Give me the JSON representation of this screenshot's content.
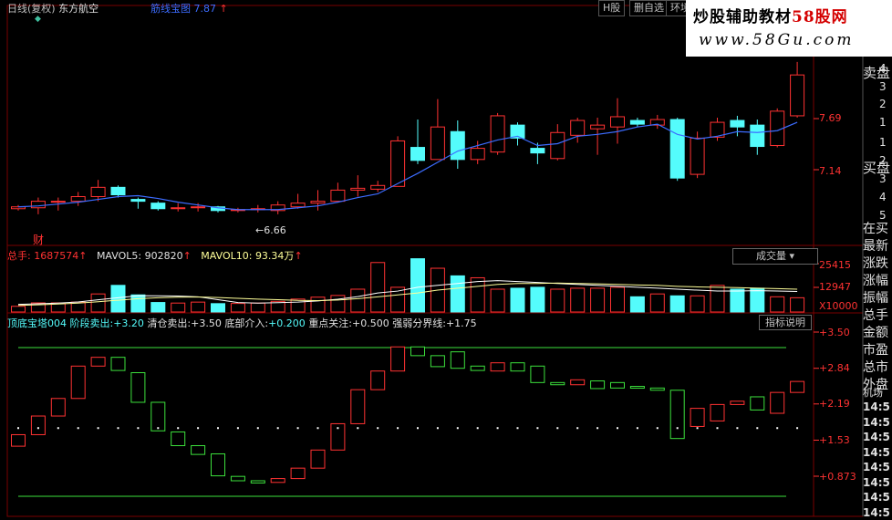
{
  "header": {
    "title": "日线(复权)",
    "stock": "东方航空",
    "indicator": "筋线宝图",
    "price": "7.87",
    "tabs": [
      "H股",
      "删自选",
      "环境"
    ]
  },
  "watermark": {
    "line1_a": "炒股辅助教材",
    "line1_b": "58股网",
    "line2": "www.58Gu.com"
  },
  "colors": {
    "up": "#ff3232",
    "down": "#54fcfc",
    "ma": "#ffffff",
    "ma2": "#ffff99",
    "bluebar": "#3c6cff"
  },
  "price_panel": {
    "ticks": [
      "7.69",
      "7.14"
    ],
    "low_label": "6.66",
    "cai_label": "财",
    "sell_label": "卖盘",
    "buy_label": "买盘",
    "sell_levels": [
      "4",
      "3",
      "2",
      "1"
    ],
    "buy_levels": [
      "1",
      "2",
      "3",
      "4",
      "5"
    ]
  },
  "volume_panel": {
    "total_label": "总手:",
    "total_value": "1687574",
    "mavol5_label": "MAVOL5:",
    "mavol5_value": "902820",
    "mavol10_label": "MAVOL10:",
    "mavol10_value": "93.34万",
    "ticks": [
      "25415",
      "12947",
      "X10000"
    ],
    "dropdown": "成交量"
  },
  "indicator_panel": {
    "name": "顶底宝塔004",
    "items": [
      {
        "label": "阶段卖出:",
        "value": "+3.20"
      },
      {
        "label": "清仓卖出:",
        "value": "+3.50"
      },
      {
        "label": "底部介入:",
        "value": "+0.200"
      },
      {
        "label": "重点关注:",
        "value": "+0.500"
      },
      {
        "label": "强弱分界线:",
        "value": "+1.75"
      }
    ],
    "ticks": [
      "+3.50",
      "+2.84",
      "+2.19",
      "+1.53",
      "+0.873"
    ],
    "button": "指标说明"
  },
  "sidebar": {
    "labels": [
      "在买",
      "最新",
      "涨跌",
      "涨幅",
      "振幅",
      "总手",
      "金额",
      "市盈",
      "总市",
      "外盘"
    ],
    "section": "机场",
    "times": [
      "14:5",
      "14:5",
      "14:5",
      "14:5",
      "14:5",
      "14:5",
      "14:5",
      "14:5"
    ]
  },
  "chart_data": [
    {
      "type": "candlestick",
      "title": "东方航空 日线",
      "yticks": [
        7.69,
        7.14
      ],
      "candles": [
        {
          "o": 6.72,
          "c": 6.74,
          "h": 6.76,
          "l": 6.7
        },
        {
          "o": 6.73,
          "c": 6.8,
          "h": 6.84,
          "l": 6.66
        },
        {
          "o": 6.8,
          "c": 6.8,
          "h": 6.84,
          "l": 6.7
        },
        {
          "o": 6.8,
          "c": 6.85,
          "h": 6.9,
          "l": 6.75
        },
        {
          "o": 6.85,
          "c": 6.95,
          "h": 7.03,
          "l": 6.8
        },
        {
          "o": 6.95,
          "c": 6.87,
          "h": 6.97,
          "l": 6.84
        },
        {
          "o": 6.82,
          "c": 6.8,
          "h": 6.84,
          "l": 6.72
        },
        {
          "o": 6.78,
          "c": 6.72,
          "h": 6.8,
          "l": 6.7
        },
        {
          "o": 6.72,
          "c": 6.73,
          "h": 6.78,
          "l": 6.69
        },
        {
          "o": 6.73,
          "c": 6.74,
          "h": 6.78,
          "l": 6.69
        },
        {
          "o": 6.74,
          "c": 6.7,
          "h": 6.75,
          "l": 6.68
        },
        {
          "o": 6.7,
          "c": 6.71,
          "h": 6.73,
          "l": 6.68
        },
        {
          "o": 6.71,
          "c": 6.72,
          "h": 6.76,
          "l": 6.68
        },
        {
          "o": 6.7,
          "c": 6.76,
          "h": 6.8,
          "l": 6.66
        },
        {
          "o": 6.74,
          "c": 6.78,
          "h": 6.88,
          "l": 6.72
        },
        {
          "o": 6.78,
          "c": 6.8,
          "h": 6.92,
          "l": 6.7
        },
        {
          "o": 6.8,
          "c": 6.92,
          "h": 7.0,
          "l": 6.8
        },
        {
          "o": 6.92,
          "c": 6.94,
          "h": 7.08,
          "l": 6.85
        },
        {
          "o": 6.93,
          "c": 6.97,
          "h": 7.02,
          "l": 6.9
        },
        {
          "o": 6.96,
          "c": 7.45,
          "h": 7.5,
          "l": 6.96
        },
        {
          "o": 7.38,
          "c": 7.24,
          "h": 7.68,
          "l": 7.2
        },
        {
          "o": 7.25,
          "c": 7.6,
          "h": 7.9,
          "l": 7.25
        },
        {
          "o": 7.55,
          "c": 7.25,
          "h": 7.67,
          "l": 7.15
        },
        {
          "o": 7.25,
          "c": 7.37,
          "h": 7.45,
          "l": 7.2
        },
        {
          "o": 7.33,
          "c": 7.72,
          "h": 7.75,
          "l": 7.3
        },
        {
          "o": 7.62,
          "c": 7.48,
          "h": 7.65,
          "l": 7.4
        },
        {
          "o": 7.37,
          "c": 7.32,
          "h": 7.43,
          "l": 7.2
        },
        {
          "o": 7.26,
          "c": 7.54,
          "h": 7.63,
          "l": 7.24
        },
        {
          "o": 7.51,
          "c": 7.67,
          "h": 7.7,
          "l": 7.43
        },
        {
          "o": 7.58,
          "c": 7.62,
          "h": 7.7,
          "l": 7.3
        },
        {
          "o": 7.6,
          "c": 7.71,
          "h": 7.91,
          "l": 7.42
        },
        {
          "o": 7.67,
          "c": 7.63,
          "h": 7.7,
          "l": 7.6
        },
        {
          "o": 7.62,
          "c": 7.68,
          "h": 7.73,
          "l": 7.58
        },
        {
          "o": 7.68,
          "c": 7.05,
          "h": 7.7,
          "l": 7.02
        },
        {
          "o": 7.09,
          "c": 7.48,
          "h": 7.55,
          "l": 7.05
        },
        {
          "o": 7.49,
          "c": 7.65,
          "h": 7.7,
          "l": 7.45
        },
        {
          "o": 7.67,
          "c": 7.6,
          "h": 7.72,
          "l": 7.5
        },
        {
          "o": 7.62,
          "c": 7.39,
          "h": 7.68,
          "l": 7.3
        },
        {
          "o": 7.4,
          "c": 7.77,
          "h": 7.8,
          "l": 7.38
        },
        {
          "o": 7.72,
          "c": 8.16,
          "h": 8.3,
          "l": 7.7
        }
      ],
      "ma": [
        6.74,
        6.75,
        6.77,
        6.79,
        6.82,
        6.85,
        6.86,
        6.83,
        6.79,
        6.76,
        6.73,
        6.71,
        6.71,
        6.71,
        6.73,
        6.75,
        6.79,
        6.84,
        6.88,
        6.99,
        7.1,
        7.22,
        7.34,
        7.4,
        7.46,
        7.5,
        7.4,
        7.42,
        7.5,
        7.52,
        7.55,
        7.6,
        7.63,
        7.52,
        7.47,
        7.5,
        7.55,
        7.54,
        7.56,
        7.65
      ]
    },
    {
      "type": "bar",
      "title": "成交量",
      "yticks": [
        25415,
        12947
      ],
      "values": [
        3000,
        4800,
        4800,
        5200,
        9500,
        14000,
        9000,
        5000,
        4700,
        5200,
        4400,
        4500,
        4700,
        5600,
        6800,
        7800,
        8700,
        12000,
        26000,
        13000,
        28000,
        23000,
        19000,
        18000,
        12000,
        12500,
        13000,
        12000,
        12500,
        12500,
        13000,
        8000,
        9500,
        8500,
        8500,
        14000,
        12000,
        12500,
        8000,
        7500
      ],
      "mavol5": [
        4000,
        4300,
        4700,
        5300,
        6400,
        7500,
        8600,
        8500,
        8400,
        8000,
        6500,
        5000,
        4700,
        4900,
        5200,
        5800,
        6700,
        8100,
        10000,
        11000,
        13000,
        14000,
        15000,
        16000,
        16500,
        16000,
        15500,
        15000,
        14500,
        14000,
        13500,
        13000,
        12500,
        12000,
        11500,
        11000,
        11000,
        11200,
        11000,
        10800
      ],
      "mavol10": [
        3500,
        3800,
        4200,
        4700,
        5400,
        6200,
        7000,
        7500,
        7800,
        7900,
        7600,
        7200,
        6800,
        6500,
        6100,
        6000,
        6300,
        7000,
        8000,
        9000,
        10000,
        11500,
        12500,
        13500,
        14500,
        15000,
        15000,
        15200,
        15000,
        14800,
        14500,
        14200,
        14000,
        13500,
        13200,
        13000,
        12800,
        12500,
        12300,
        12000
      ]
    },
    {
      "type": "bar",
      "title": "顶底宝塔004",
      "yticks": [
        3.5,
        2.84,
        2.19,
        1.53,
        0.873
      ],
      "strength_line": 1.75,
      "bars": [
        {
          "o": 1.42,
          "c": 1.63
        },
        {
          "o": 1.63,
          "c": 1.97
        },
        {
          "o": 1.97,
          "c": 2.29
        },
        {
          "o": 2.29,
          "c": 2.88
        },
        {
          "o": 2.88,
          "c": 3.04
        },
        {
          "o": 3.04,
          "c": 2.8
        },
        {
          "o": 2.76,
          "c": 2.22
        },
        {
          "o": 2.22,
          "c": 1.7
        },
        {
          "o": 1.68,
          "c": 1.43
        },
        {
          "o": 1.43,
          "c": 1.27
        },
        {
          "o": 1.28,
          "c": 0.88
        },
        {
          "o": 0.87,
          "c": 0.79
        },
        {
          "o": 0.79,
          "c": 0.75
        },
        {
          "o": 0.76,
          "c": 0.83
        },
        {
          "o": 0.83,
          "c": 1.02
        },
        {
          "o": 1.02,
          "c": 1.35
        },
        {
          "o": 1.35,
          "c": 1.83
        },
        {
          "o": 1.83,
          "c": 2.45
        },
        {
          "o": 2.45,
          "c": 2.79
        },
        {
          "o": 2.79,
          "c": 3.23
        },
        {
          "o": 3.23,
          "c": 3.07
        },
        {
          "o": 3.07,
          "c": 2.87
        },
        {
          "o": 3.14,
          "c": 2.84
        },
        {
          "o": 2.88,
          "c": 2.8
        },
        {
          "o": 2.79,
          "c": 2.94
        },
        {
          "o": 2.94,
          "c": 2.79
        },
        {
          "o": 2.88,
          "c": 2.58
        },
        {
          "o": 2.58,
          "c": 2.54
        },
        {
          "o": 2.54,
          "c": 2.63
        },
        {
          "o": 2.61,
          "c": 2.47
        },
        {
          "o": 2.58,
          "c": 2.48
        },
        {
          "o": 2.51,
          "c": 2.48
        },
        {
          "o": 2.48,
          "c": 2.44
        },
        {
          "o": 2.44,
          "c": 1.56
        },
        {
          "o": 1.78,
          "c": 2.11
        },
        {
          "o": 1.88,
          "c": 2.18
        },
        {
          "o": 2.18,
          "c": 2.24
        },
        {
          "o": 2.32,
          "c": 2.08
        },
        {
          "o": 2.02,
          "c": 2.4
        },
        {
          "o": 2.4,
          "c": 2.6
        }
      ]
    }
  ]
}
